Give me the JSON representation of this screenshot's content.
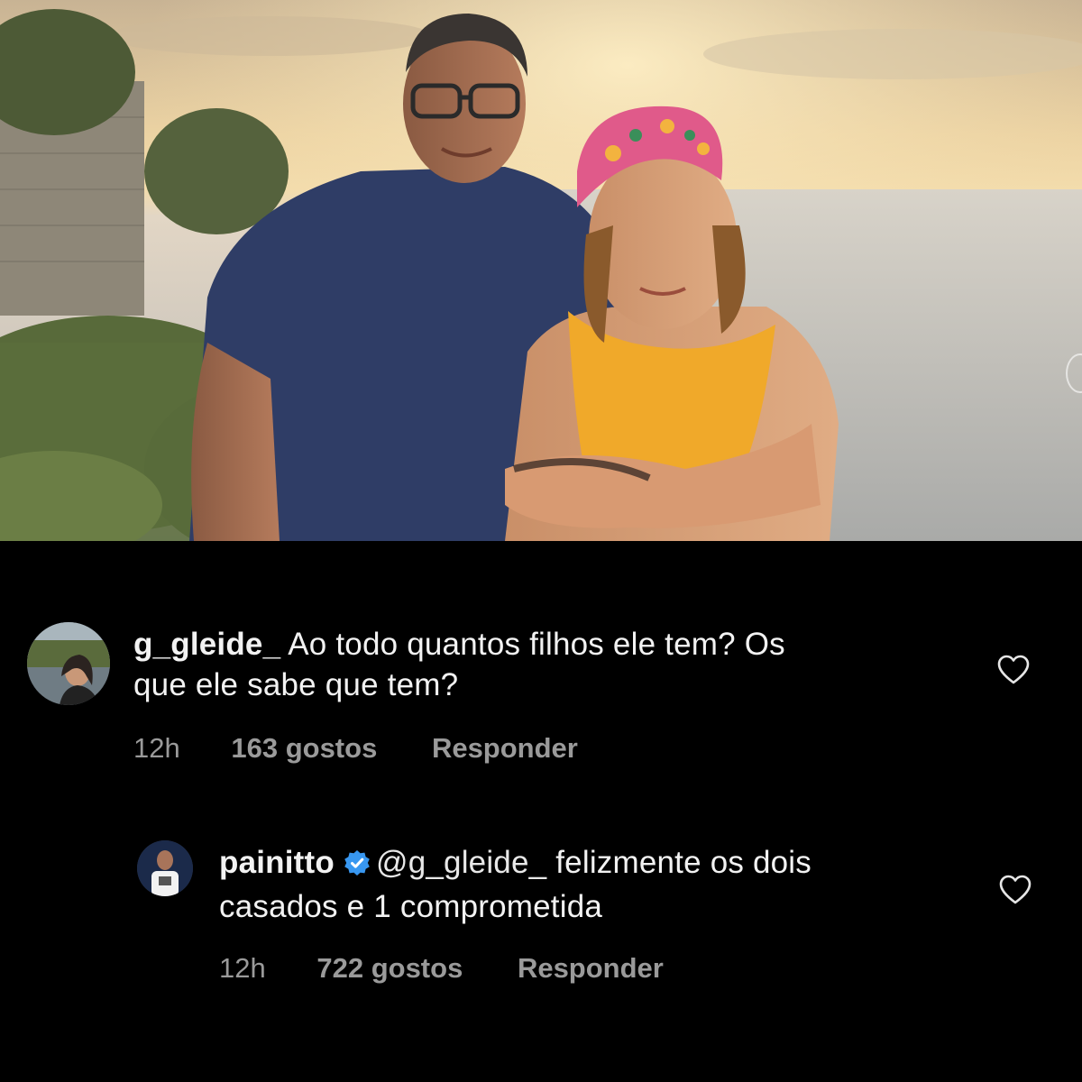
{
  "post": {
    "image_alt": "Foto de um homem de óculos e camiseta azul ao lado de uma mulher de lenço colorido e top amarelo, com o mar ao pôr do sol ao fundo"
  },
  "comments": [
    {
      "username": "g_gleide_",
      "text": "Ao todo quantos filhos ele tem? Os",
      "text_line2": "que ele sabe que tem?",
      "time": "12h",
      "likes": "163 gostos",
      "reply_label": "Responder",
      "avatar_icon": "profile-photo"
    },
    {
      "username": "painitto",
      "verified": true,
      "mention": "@g_gleide_",
      "text": "felizmente os dois",
      "text_line2": "casados e 1 comprometida",
      "time": "12h",
      "likes": "722 gostos",
      "reply_label": "Responder",
      "avatar_icon": "profile-photo"
    }
  ],
  "colors": {
    "background": "#000000",
    "text": "#f2f2f2",
    "meta": "#9a9a9a",
    "verified": "#3897f0"
  },
  "icons": {
    "like": "heart-outline-icon",
    "verified": "verified-badge-icon"
  }
}
